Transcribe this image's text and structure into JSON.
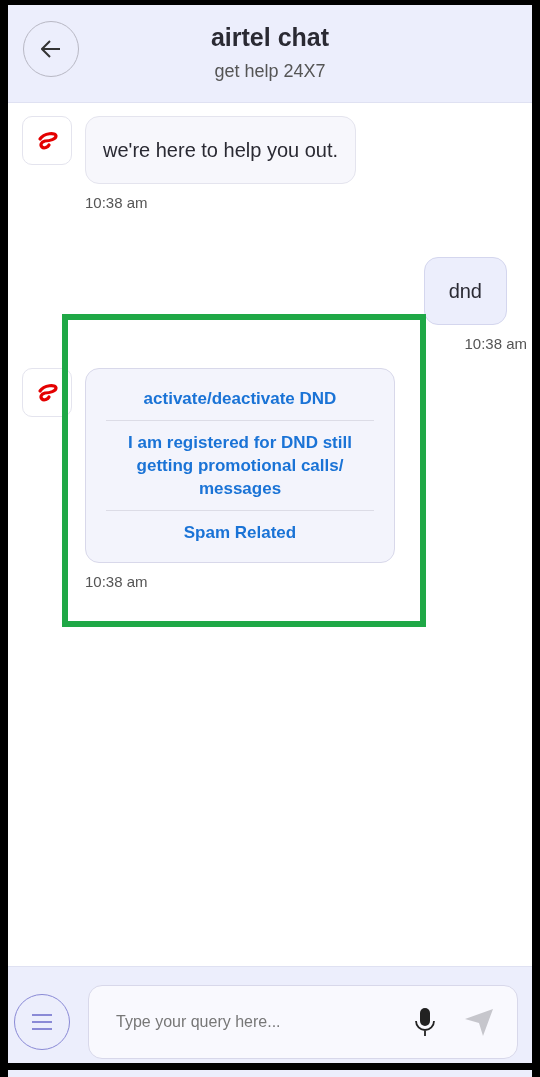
{
  "header": {
    "title": "airtel chat",
    "subtitle": "get help 24X7"
  },
  "messages": [
    {
      "kind": "bot_text",
      "text": "we're here to help you out.",
      "time": "10:38 am",
      "highlighted": false
    },
    {
      "kind": "user_text",
      "text": "dnd",
      "time": "10:38 am",
      "highlighted": false
    },
    {
      "kind": "bot_options",
      "options": [
        "activate/deactivate DND",
        "I am registered for DND still getting promotional calls/ messages",
        "Spam Related"
      ],
      "time": "10:38 am",
      "highlighted": true
    }
  ],
  "composer": {
    "placeholder": "Type your query here..."
  }
}
